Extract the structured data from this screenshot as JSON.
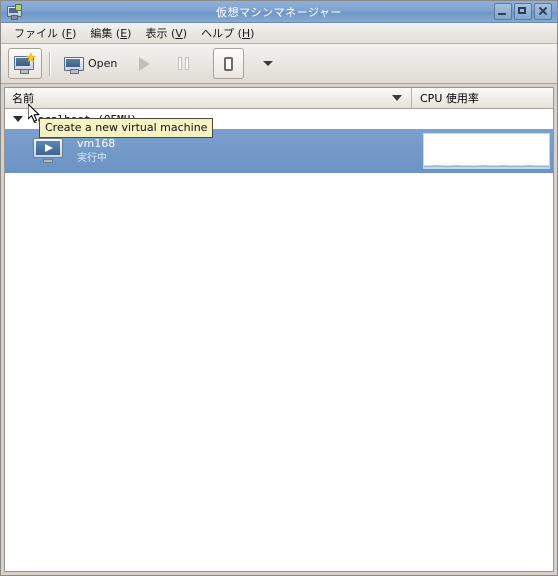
{
  "window": {
    "title": "仮想マシンマネージャー",
    "icon": "computer-icon",
    "buttons": {
      "minimize": "minimize-button",
      "maximize": "maximize-button",
      "close": "close-button"
    }
  },
  "menubar": {
    "items": [
      {
        "label": "ファイル (F)",
        "text": "ファイル (",
        "mnemonic": "F",
        "tail": ")"
      },
      {
        "label": "編集 (E)",
        "text": "編集 (",
        "mnemonic": "E",
        "tail": ")"
      },
      {
        "label": "表示 (V)",
        "text": "表示 (",
        "mnemonic": "V",
        "tail": ")"
      },
      {
        "label": "ヘルプ (H)",
        "text": "ヘルプ (",
        "mnemonic": "H",
        "tail": ")"
      }
    ]
  },
  "toolbar": {
    "new_vm": {
      "name": "new-virtual-machine-button",
      "label": ""
    },
    "open": {
      "name": "open-button",
      "label": "Open"
    },
    "run": {
      "name": "run-button",
      "label": "",
      "enabled": false
    },
    "pause": {
      "name": "pause-button",
      "label": "",
      "enabled": false
    },
    "shutdown": {
      "name": "shutdown-button",
      "label": "",
      "enabled": true
    },
    "more": {
      "name": "more-options-button",
      "label": ""
    }
  },
  "tooltip": {
    "text": "Create a new virtual machine"
  },
  "list": {
    "columns": [
      {
        "key": "name",
        "label": "名前",
        "sort_indicator": "chevron-down-icon"
      },
      {
        "key": "cpu",
        "label": "CPU 使用率"
      }
    ],
    "connections": [
      {
        "name": "localhost (QEMU)",
        "expanded": true,
        "guests": [
          {
            "name": "vm168",
            "status": "実行中",
            "selected": true,
            "cpu_sparkline": [
              2,
              2,
              3,
              2,
              2,
              3,
              2,
              2,
              2,
              3,
              2,
              2,
              3,
              2,
              2,
              2,
              3,
              2,
              2,
              2
            ]
          }
        ]
      }
    ]
  },
  "colors": {
    "titlebar": "#7fa4d0",
    "selection": "#6b93c5",
    "tooltip_bg": "#f7f2c2",
    "cpu_line": "#8fbcd9",
    "accent_star": "#f5c915"
  }
}
